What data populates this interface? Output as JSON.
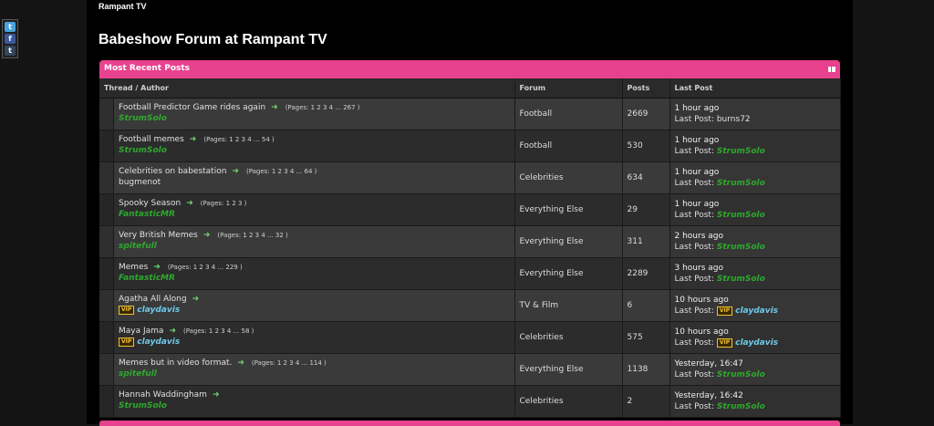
{
  "site": {
    "name": "Rampant TV"
  },
  "page": {
    "title": "Babeshow Forum at Rampant TV"
  },
  "share": {
    "twitter_glyph": "t",
    "facebook_glyph": "f",
    "tumblr_glyph": "t"
  },
  "panel": {
    "title": "Most Recent Posts",
    "columns": [
      "Thread / Author",
      "Forum",
      "Posts",
      "Last Post"
    ]
  },
  "last_post_prefix": "Last Post: ",
  "threads": [
    {
      "title": "Football Predictor Game rides again",
      "pages": "(Pages: 1 2 3 4 ... 267 )",
      "author": "StrumSolo",
      "author_style": "green",
      "author_vip": false,
      "forum": "Football",
      "posts": "2669",
      "last_time": "1 hour ago",
      "last_by": "burns72",
      "last_by_style": "plain",
      "last_by_vip": false
    },
    {
      "title": "Football memes",
      "pages": "(Pages: 1 2 3 4 ... 54 )",
      "author": "StrumSolo",
      "author_style": "green",
      "author_vip": false,
      "forum": "Football",
      "posts": "530",
      "last_time": "1 hour ago",
      "last_by": "StrumSolo",
      "last_by_style": "green",
      "last_by_vip": false
    },
    {
      "title": "Celebrities on babestation",
      "pages": "(Pages: 1 2 3 4 ... 64 )",
      "author": "bugmenot",
      "author_style": "plain",
      "author_vip": false,
      "forum": "Celebrities",
      "posts": "634",
      "last_time": "1 hour ago",
      "last_by": "StrumSolo",
      "last_by_style": "green",
      "last_by_vip": false
    },
    {
      "title": "Spooky Season",
      "pages": "(Pages: 1 2 3 )",
      "author": "FantasticMR",
      "author_style": "green",
      "author_vip": false,
      "forum": "Everything Else",
      "posts": "29",
      "last_time": "1 hour ago",
      "last_by": "StrumSolo",
      "last_by_style": "green",
      "last_by_vip": false
    },
    {
      "title": "Very British Memes",
      "pages": "(Pages: 1 2 3 4 ... 32 )",
      "author": "spitefull",
      "author_style": "green",
      "author_vip": false,
      "forum": "Everything Else",
      "posts": "311",
      "last_time": "2 hours ago",
      "last_by": "StrumSolo",
      "last_by_style": "green",
      "last_by_vip": false
    },
    {
      "title": "Memes",
      "pages": "(Pages: 1 2 3 4 ... 229 )",
      "author": "FantasticMR",
      "author_style": "green",
      "author_vip": false,
      "forum": "Everything Else",
      "posts": "2289",
      "last_time": "3 hours ago",
      "last_by": "StrumSolo",
      "last_by_style": "green",
      "last_by_vip": false
    },
    {
      "title": "Agatha All Along",
      "pages": "",
      "author": "claydavis",
      "author_style": "vip",
      "author_vip": true,
      "forum": "TV & Film",
      "posts": "6",
      "last_time": "10 hours ago",
      "last_by": "claydavis",
      "last_by_style": "vip",
      "last_by_vip": true
    },
    {
      "title": "Maya Jama",
      "pages": "(Pages: 1 2 3 4 ... 58 )",
      "author": "claydavis",
      "author_style": "vip",
      "author_vip": true,
      "forum": "Celebrities",
      "posts": "575",
      "last_time": "10 hours ago",
      "last_by": "claydavis",
      "last_by_style": "vip",
      "last_by_vip": true
    },
    {
      "title": "Memes but in video format.",
      "pages": "(Pages: 1 2 3 4 ... 114 )",
      "author": "spitefull",
      "author_style": "green",
      "author_vip": false,
      "forum": "Everything Else",
      "posts": "1138",
      "last_time": "Yesterday, 16:47",
      "last_by": "StrumSolo",
      "last_by_style": "green",
      "last_by_vip": false
    },
    {
      "title": "Hannah Waddingham",
      "pages": "",
      "author": "StrumSolo",
      "author_style": "green",
      "author_vip": false,
      "forum": "Celebrities",
      "posts": "2",
      "last_time": "Yesterday, 16:42",
      "last_by": "StrumSolo",
      "last_by_style": "green",
      "last_by_vip": false
    }
  ],
  "vip_label": "VIP",
  "arrow_glyph": "➜"
}
